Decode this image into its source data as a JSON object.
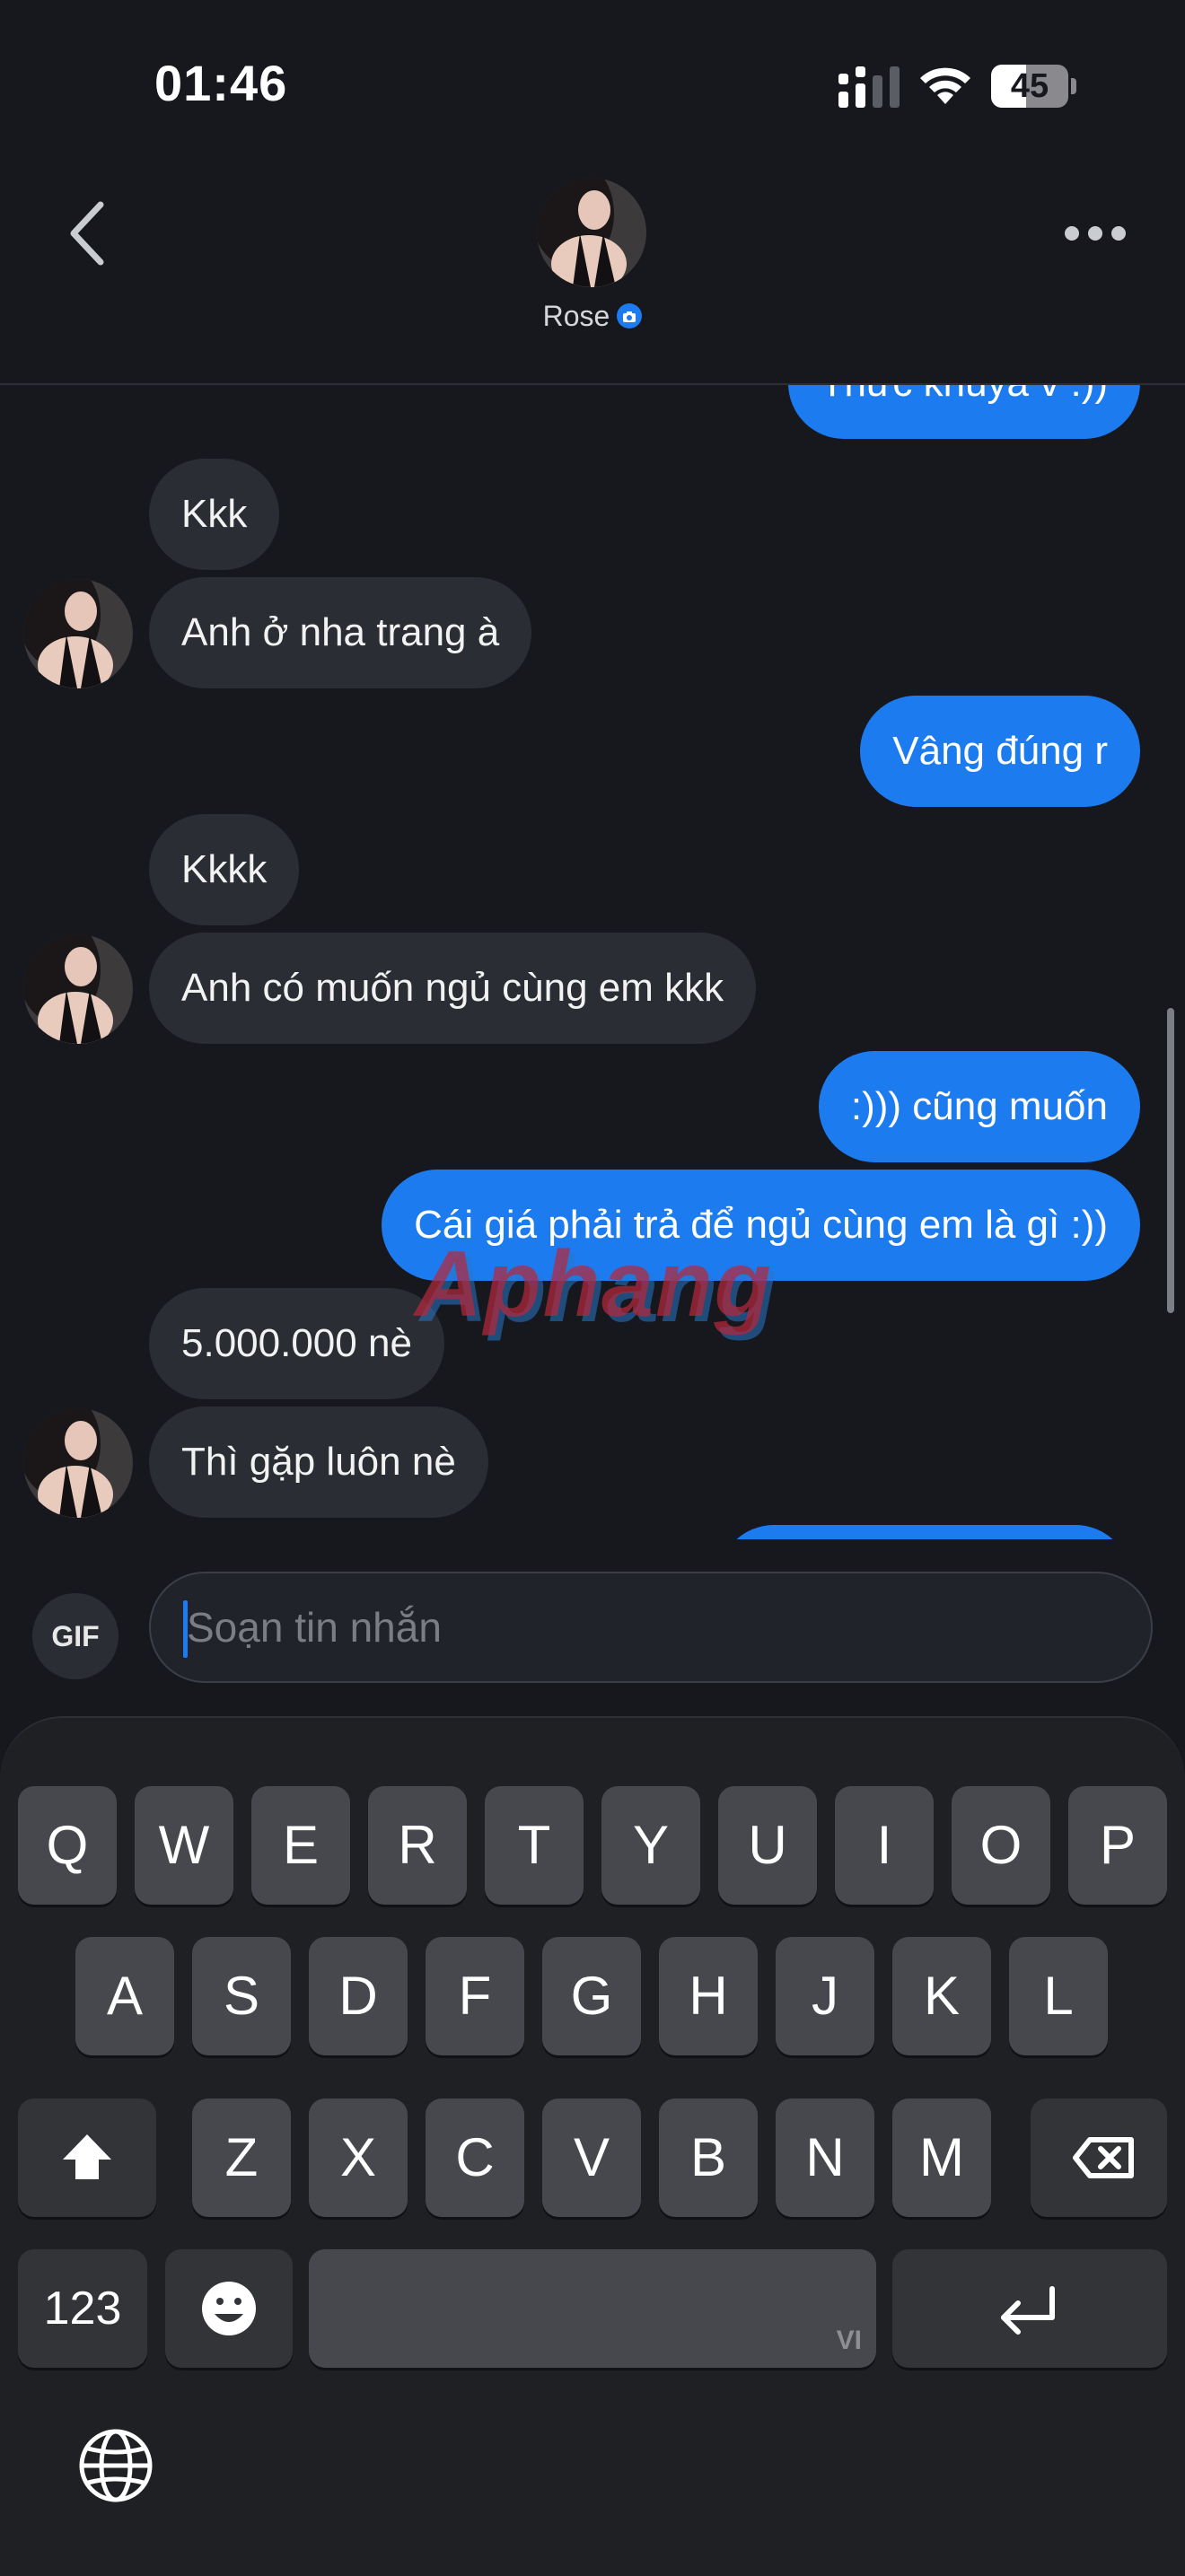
{
  "status_bar": {
    "time": "01:46",
    "battery": "45",
    "battery_level": 0.45
  },
  "header": {
    "contact_name": "Rose"
  },
  "messages": [
    {
      "direction": "out",
      "text": "Thức khuya v :))"
    },
    {
      "direction": "in",
      "text": "Kkk"
    },
    {
      "direction": "in",
      "text": "Anh ở nha trang à"
    },
    {
      "direction": "out",
      "text": "Vâng đúng r"
    },
    {
      "direction": "in",
      "text": "Kkkk"
    },
    {
      "direction": "in",
      "text": "Anh có muốn ngủ cùng em kkk"
    },
    {
      "direction": "out",
      "text": ":))) cũng muốn"
    },
    {
      "direction": "out",
      "text": "Cái giá phải trả để ngủ cùng em là gì :))"
    },
    {
      "direction": "in",
      "text": "5.000.000 nè"
    },
    {
      "direction": "in",
      "text": "Thì gặp luôn nè"
    }
  ],
  "watermark": "Aphang",
  "composer": {
    "gif_label": "GIF",
    "placeholder": "Soạn tin nhắn"
  },
  "keyboard": {
    "row1": [
      "Q",
      "W",
      "E",
      "R",
      "T",
      "Y",
      "U",
      "I",
      "O",
      "P"
    ],
    "row2": [
      "A",
      "S",
      "D",
      "F",
      "G",
      "H",
      "J",
      "K",
      "L"
    ],
    "row3": [
      "Z",
      "X",
      "C",
      "V",
      "B",
      "N",
      "M"
    ],
    "numbers_label": "123",
    "space_language": "VI"
  },
  "colors": {
    "background": "#16181d",
    "outgoing_bubble": "#1d7bf0",
    "incoming_bubble": "#2a2d34",
    "key": "#46484d",
    "function_key": "#323438"
  },
  "icons": {
    "back": "chevron-left-icon",
    "more": "ellipsis-icon",
    "shift": "shift-arrow-icon",
    "backspace": "backspace-icon",
    "emoji": "emoji-icon",
    "return": "return-arrow-icon",
    "globe": "globe-icon"
  }
}
